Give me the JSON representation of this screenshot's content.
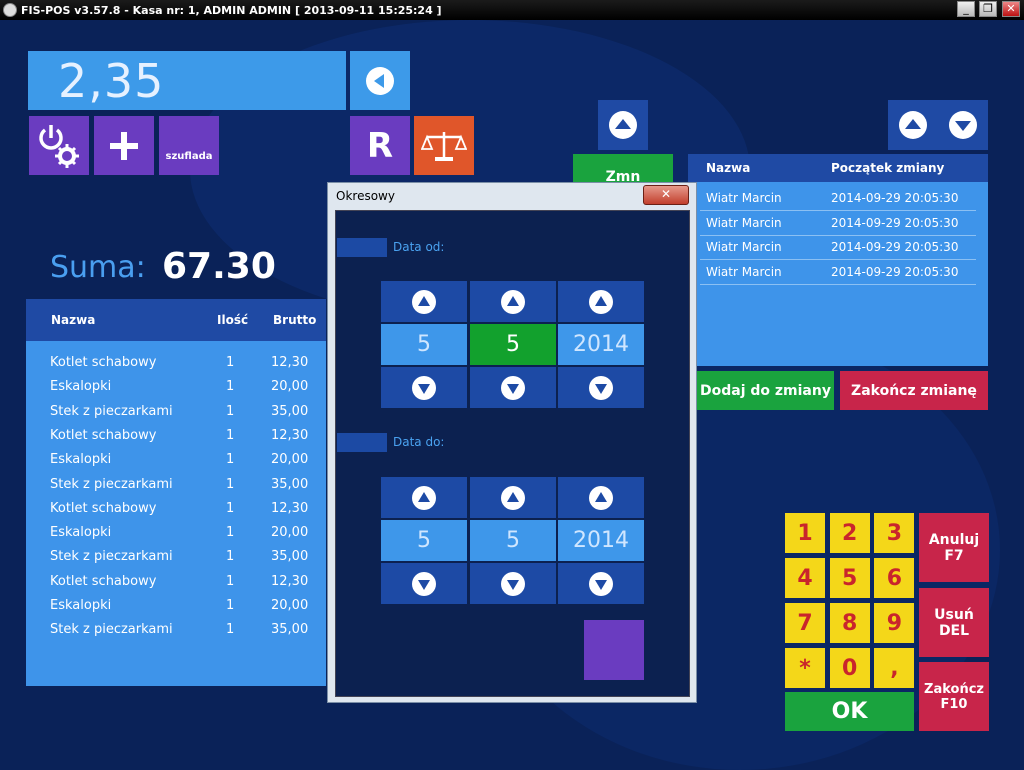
{
  "window": {
    "title": "FIS-POS v3.57.8 - Kasa nr: 1, ADMIN ADMIN [ 2013-09-11 15:25:24 ]",
    "minimize": "_",
    "maximize": "❐",
    "close": "✕"
  },
  "display": {
    "value": "2,35"
  },
  "toolbar": {
    "drawer_label": "szuflada",
    "r_label": "R"
  },
  "sum": {
    "label": "Suma:",
    "value": "67.30"
  },
  "order": {
    "headers": {
      "name": "Nazwa",
      "qty": "Ilość",
      "gross": "Brutto"
    },
    "rows": [
      {
        "name": "Kotlet schabowy",
        "qty": "1",
        "gross": "12,30"
      },
      {
        "name": "Eskalopki",
        "qty": "1",
        "gross": "20,00"
      },
      {
        "name": "Stek z pieczarkami",
        "qty": "1",
        "gross": "35,00"
      },
      {
        "name": "Kotlet schabowy",
        "qty": "1",
        "gross": "12,30"
      },
      {
        "name": "Eskalopki",
        "qty": "1",
        "gross": "20,00"
      },
      {
        "name": "Stek z pieczarkami",
        "qty": "1",
        "gross": "35,00"
      },
      {
        "name": "Kotlet schabowy",
        "qty": "1",
        "gross": "12,30"
      },
      {
        "name": "Eskalopki",
        "qty": "1",
        "gross": "20,00"
      },
      {
        "name": "Stek z pieczarkami",
        "qty": "1",
        "gross": "35,00"
      },
      {
        "name": "Kotlet schabowy",
        "qty": "1",
        "gross": "12,30"
      },
      {
        "name": "Eskalopki",
        "qty": "1",
        "gross": "20,00"
      },
      {
        "name": "Stek z pieczarkami",
        "qty": "1",
        "gross": "35,00"
      }
    ]
  },
  "dialog": {
    "title": "Okresowy",
    "from": {
      "label": "Data od:",
      "day": "5",
      "month": "5",
      "year": "2014"
    },
    "to": {
      "label": "Data do:",
      "day": "5",
      "month": "5",
      "year": "2014"
    }
  },
  "green_button_partial": "Zmn",
  "shifts": {
    "headers": {
      "name": "Nazwa",
      "start": "Początek zmiany"
    },
    "rows": [
      {
        "name": "Wiatr Marcin",
        "start": "2014-09-29 20:05:30"
      },
      {
        "name": "Wiatr Marcin",
        "start": "2014-09-29 20:05:30"
      },
      {
        "name": "Wiatr Marcin",
        "start": "2014-09-29 20:05:30"
      },
      {
        "name": "Wiatr Marcin",
        "start": "2014-09-29 20:05:30"
      }
    ],
    "add_label": "Dodaj do zmiany",
    "end_label": "Zakończ zmianę"
  },
  "keypad": {
    "keys": [
      "1",
      "2",
      "3",
      "4",
      "5",
      "6",
      "7",
      "8",
      "9",
      "*",
      "0",
      ","
    ],
    "cancel_label_1": "Anuluj",
    "cancel_label_2": "F7",
    "delete_label_1": "Usuń",
    "delete_label_2": "DEL",
    "finish_label_1": "Zakończ",
    "finish_label_2": "F10",
    "ok_label": "OK"
  },
  "colors": {
    "background": "#0a2258",
    "light_blue": "#3e94ea",
    "dark_blue": "#1f4aa4",
    "purple": "#6a3cc0",
    "orange": "#e0562a",
    "green": "#1aa33e",
    "red": "#c8254a",
    "yellow": "#f4d719"
  }
}
